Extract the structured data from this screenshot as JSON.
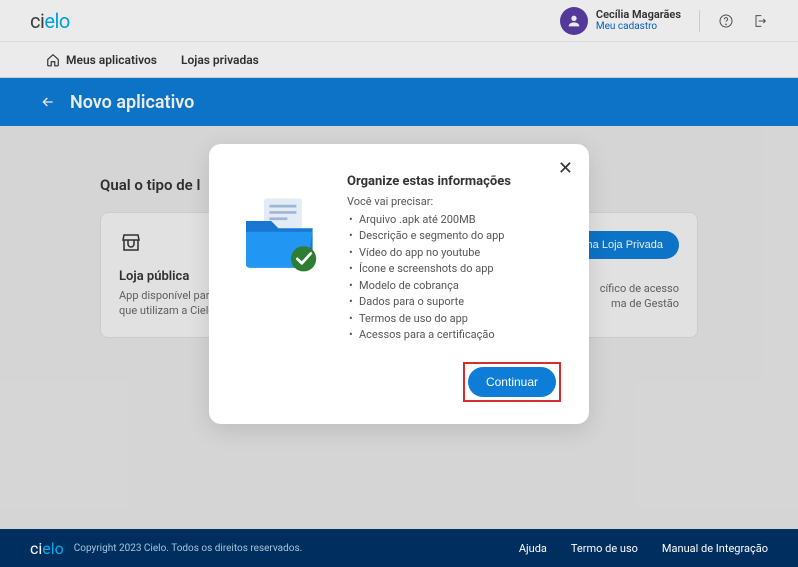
{
  "header": {
    "logo_ci": "ci",
    "logo_elo": "elo",
    "user_name": "Cecília Magarães",
    "user_link": "Meu cadastro"
  },
  "nav": {
    "my_apps": "Meus aplicativos",
    "private_stores": "Lojas privadas"
  },
  "banner": {
    "title": "Novo aplicativo"
  },
  "page": {
    "content_title": "Qual o tipo de l"
  },
  "cards": {
    "public": {
      "title": "Loja pública",
      "desc1": "App disponível para",
      "desc2": "que utilizam a Cielo"
    },
    "private": {
      "btn_fragment": "ir na Loja Privada",
      "desc1": "cífico de acesso",
      "desc2": "ma de Gestão"
    }
  },
  "modal": {
    "title": "Organize estas informações",
    "subtitle": "Você vai precisar:",
    "items": [
      "Arquivo .apk até 200MB",
      "Descrição e segmento do app",
      "Vídeo do app no youtube",
      "Ícone e screenshots do app",
      "Modelo de cobrança",
      "Dados para o suporte",
      "Termos de uso do app",
      "Acessos para a certificação"
    ],
    "continue": "Continuar"
  },
  "footer": {
    "copy": "Copyright 2023 Cielo. Todos os direitos reservados.",
    "links": [
      "Ajuda",
      "Termo de uso",
      "Manual de Integração"
    ]
  }
}
